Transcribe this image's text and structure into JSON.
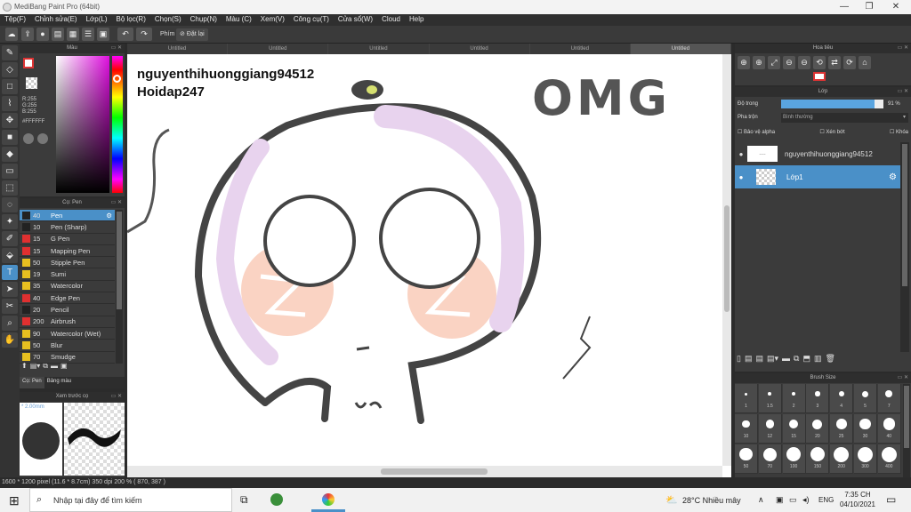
{
  "window": {
    "title": "MediBang Paint Pro (64bit)",
    "minimize": "—",
    "maximize": "❐",
    "close": "✕"
  },
  "menu": [
    "Tệp(F)",
    "Chỉnh sửa(E)",
    "Lớp(L)",
    "Bộ lọc(R)",
    "Chọn(S)",
    "Chụp(N)",
    "Màu (C)",
    "Xem(V)",
    "Công cụ(T)",
    "Cửa sổ(W)",
    "Cloud",
    "Help"
  ],
  "toolbar": {
    "key_label": "Phím",
    "reset_label": "Đặt lại"
  },
  "color_panel": {
    "title": "Màu",
    "r": "R:255",
    "g": "G:255",
    "b": "B:255",
    "hex": "#FFFFFF"
  },
  "brush_panel": {
    "title": "Cọ: Pen",
    "items": [
      {
        "size": "40",
        "name": "Pen",
        "color": "#222222"
      },
      {
        "size": "10",
        "name": "Pen (Sharp)",
        "color": "#222222"
      },
      {
        "size": "15",
        "name": "G Pen",
        "color": "#e03030"
      },
      {
        "size": "15",
        "name": "Mapping Pen",
        "color": "#e03030"
      },
      {
        "size": "50",
        "name": "Stipple Pen",
        "color": "#e8c020"
      },
      {
        "size": "19",
        "name": "Sumi",
        "color": "#e8c020"
      },
      {
        "size": "35",
        "name": "Watercolor",
        "color": "#e8c020"
      },
      {
        "size": "40",
        "name": "Edge Pen",
        "color": "#e03030"
      },
      {
        "size": "20",
        "name": "Pencil",
        "color": "#222222"
      },
      {
        "size": "200",
        "name": "Airbrush",
        "color": "#e03030"
      },
      {
        "size": "90",
        "name": "Watercolor (Wet)",
        "color": "#e8c020"
      },
      {
        "size": "50",
        "name": "Blur",
        "color": "#e8c020"
      },
      {
        "size": "70",
        "name": "Smudge",
        "color": "#e8c020"
      }
    ],
    "tab1": "Cọ: Pen",
    "tab2": "Bảng màu"
  },
  "preview_panel": {
    "title": "Xem trước cọ",
    "size": "2.00mm"
  },
  "tabs": [
    "Untitled",
    "Untitled",
    "Untitled",
    "Untitled",
    "Untitled",
    "Untitled"
  ],
  "canvas": {
    "username": "nguyenthihuonggiang94512",
    "site": "Hoidap247",
    "omg": "OMG"
  },
  "status": {
    "text": "1600 * 1200 pixel   (11.6 * 8.7cm)   350 dpi   200 %   ( 870, 387 )"
  },
  "navigator": {
    "title": "Hoa tiêu"
  },
  "layer_panel": {
    "title": "Lớp",
    "opacity_label": "Độ trong",
    "opacity_value": "91 %",
    "opacity_level": 0.91,
    "blend_label": "Pha trộn",
    "blend_value": "Bình thường",
    "protect_alpha": "Bảo vệ alpha",
    "clipping": "Xén bớt",
    "lock": "Khóa",
    "layers": [
      {
        "name": "nguyenthihuonggiang94512"
      },
      {
        "name": "Lớp1"
      }
    ]
  },
  "brushsize_panel": {
    "title": "Brush Size",
    "sizes": [
      "1",
      "1.5",
      "2",
      "3",
      "4",
      "5",
      "7",
      "10",
      "12",
      "15",
      "20",
      "25",
      "30",
      "40",
      "50",
      "70",
      "100",
      "150",
      "200",
      "300",
      "400"
    ]
  },
  "taskbar": {
    "search_placeholder": "Nhập tại đây để tìm kiếm",
    "weather": "28°C  Nhiều mây",
    "lang": "ENG",
    "time": "7:35 CH",
    "date": "04/10/2021"
  }
}
